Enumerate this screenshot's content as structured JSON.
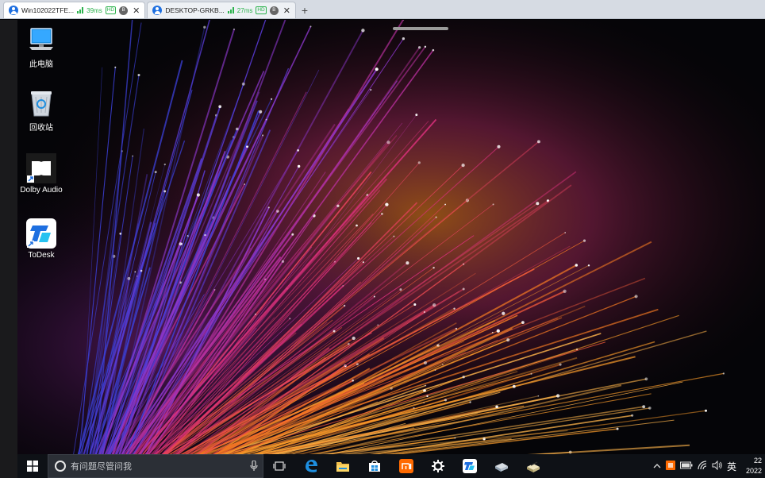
{
  "tabs": [
    {
      "name": "Win102022TFE...",
      "latency": "39ms",
      "quality": "HD",
      "monitor": "B"
    },
    {
      "name": "DESKTOP-GRKB...",
      "latency": "27ms",
      "quality": "HD",
      "monitor": "B"
    }
  ],
  "new_tab_label": "+",
  "desktop_icons": [
    {
      "label": "此电脑",
      "icon": "computer-icon"
    },
    {
      "label": "回收站",
      "icon": "recycle-bin-icon"
    },
    {
      "label": "Dolby Audio",
      "icon": "dolby-audio-icon"
    },
    {
      "label": "ToDesk",
      "icon": "todesk-icon"
    }
  ],
  "taskbar": {
    "search_placeholder": "有问题尽管问我",
    "pinned": [
      "task-view-icon",
      "edge-icon",
      "file-explorer-icon",
      "store-icon",
      "mi-icon",
      "settings-icon",
      "todesk-icon",
      "app-icon-1",
      "app-icon-2"
    ],
    "tray": {
      "ime": "英",
      "clock_time": "22",
      "clock_date": "2022"
    }
  },
  "colors": {
    "taskbar": "#0e1116",
    "edge_blue": "#1e8fe0",
    "mi_orange": "#ff6a00",
    "latency_green": "#2bb24c",
    "todesk_blue": "#1e6fe0"
  }
}
